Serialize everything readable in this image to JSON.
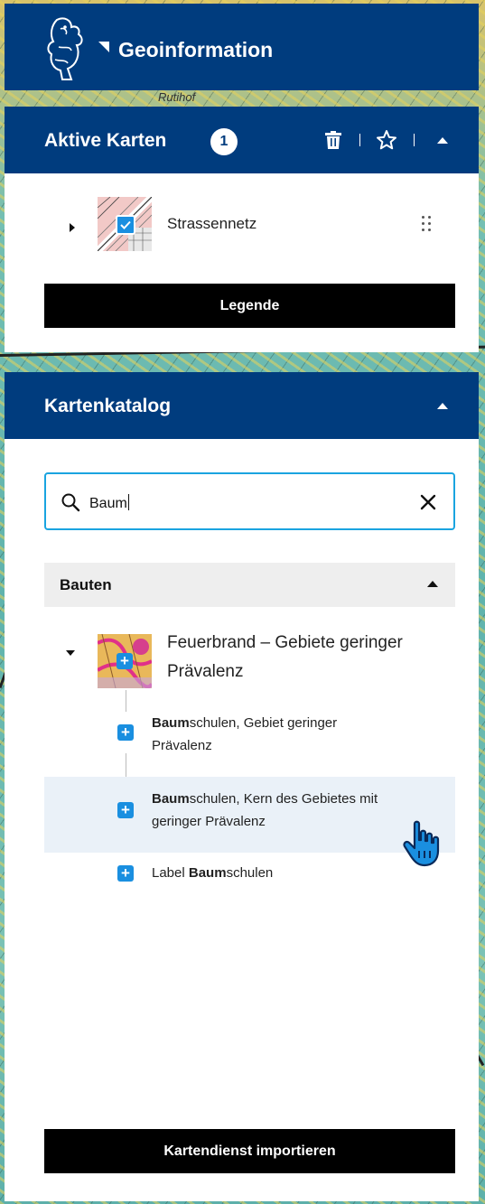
{
  "app": {
    "title": "Geoinformation"
  },
  "active_maps": {
    "title": "Aktive Karten",
    "count": "1",
    "layers": [
      {
        "name": "Strassennetz",
        "checked": true
      }
    ],
    "legend_button": "Legende"
  },
  "catalog": {
    "title": "Kartenkatalog",
    "search": {
      "value": "Baum"
    },
    "groups": [
      {
        "title": "Bauten",
        "expanded": true,
        "parent_line1": "Feuerbrand – Gebiete geringer",
        "parent_line2": "Prävalenz",
        "children": [
          {
            "bold": "Baum",
            "rest1": "schulen, Gebiet geringer",
            "line2": "Prävalenz"
          },
          {
            "bold": "Baum",
            "rest1": "schulen, Kern des Gebietes mit",
            "line2": "geringer Prävalenz"
          },
          {
            "prefix": "Label ",
            "bold": "Baum",
            "rest1": "schulen"
          }
        ]
      }
    ],
    "import_button": "Kartendienst importieren"
  },
  "icons": [
    "lion-logo-icon",
    "trash-icon",
    "star-icon",
    "chevron-up-icon",
    "search-icon",
    "close-icon",
    "drag-handle-icon",
    "plus-icon",
    "hand-cursor-icon"
  ],
  "colors": {
    "header_blue": "#003c7e",
    "accent_blue": "#1a8fe0",
    "search_border": "#1aa4e0"
  },
  "map_fragments": {
    "top": "Rutihof"
  }
}
